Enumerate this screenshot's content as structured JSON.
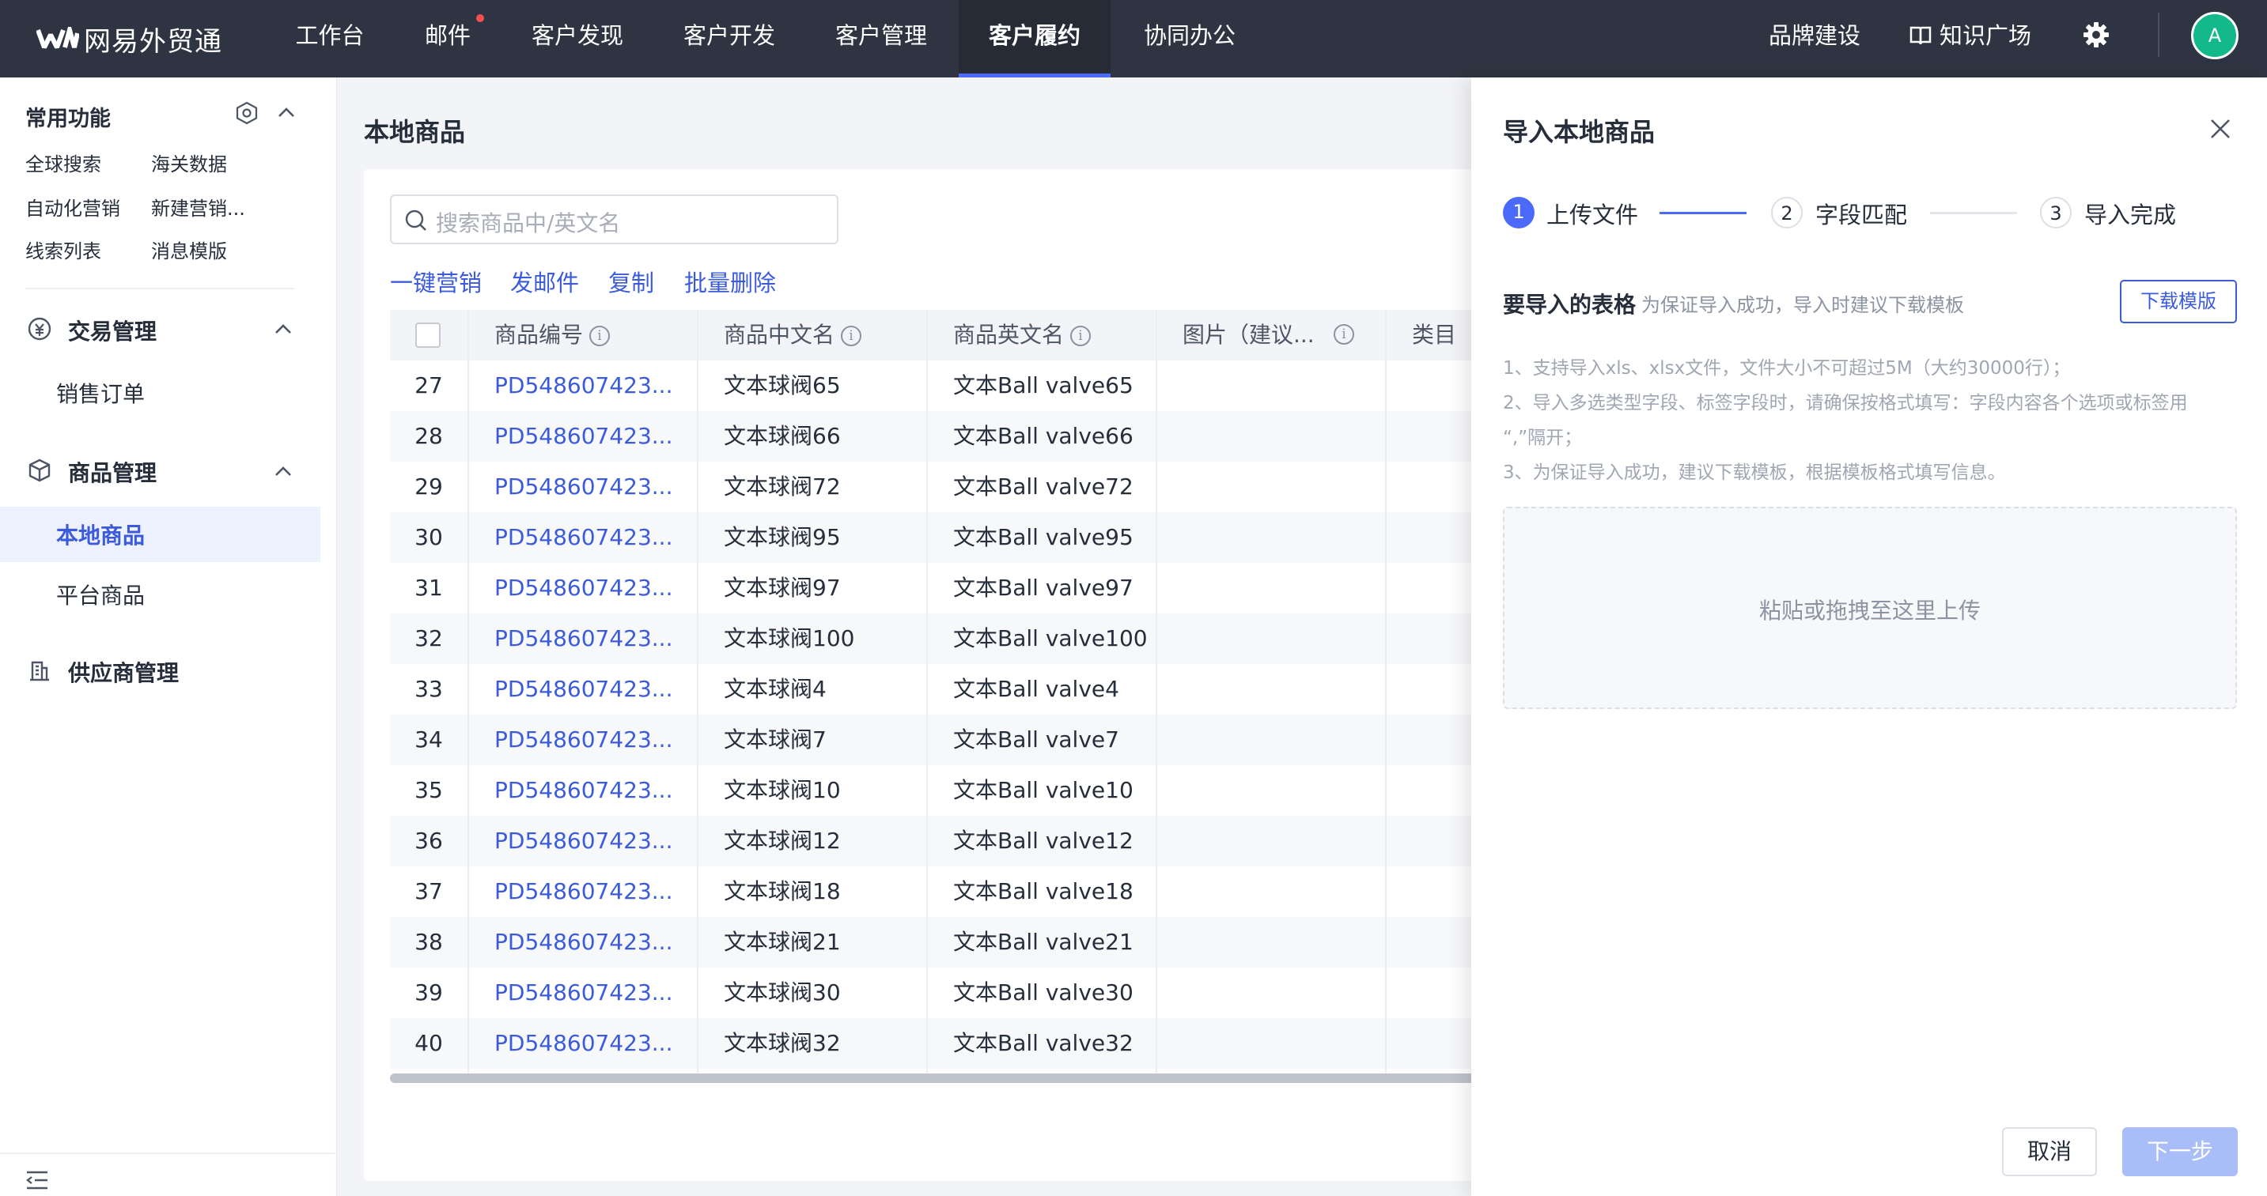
{
  "app": {
    "name": "网易外贸通"
  },
  "nav": {
    "tabs": [
      "工作台",
      "邮件",
      "客户发现",
      "客户开发",
      "客户管理",
      "客户履约",
      "协同办公"
    ],
    "active": "客户履约",
    "right": {
      "brand": "品牌建设",
      "knowledge": "知识广场",
      "avatar": "A"
    }
  },
  "sidebar": {
    "common_title": "常用功能",
    "quick_links": [
      "全球搜索",
      "海关数据",
      "自动化营销",
      "新建营销...",
      "线索列表",
      "消息模版"
    ],
    "groups": [
      {
        "title": "交易管理",
        "items": [
          "销售订单"
        ]
      },
      {
        "title": "商品管理",
        "items": [
          "本地商品",
          "平台商品"
        ]
      },
      {
        "title": "供应商管理",
        "items": []
      }
    ],
    "active_item": "本地商品"
  },
  "page": {
    "title": "本地商品",
    "search_placeholder": "搜索商品中/英文名",
    "actions": [
      "一键营销",
      "发邮件",
      "复制",
      "批量删除"
    ],
    "columns": [
      "商品编号",
      "商品中文名",
      "商品英文名",
      "图片（建议...",
      "类目"
    ],
    "rows": [
      {
        "no": "27",
        "id": "PD548607423...",
        "cn": "文本球阀65",
        "en": "文本Ball valve65"
      },
      {
        "no": "28",
        "id": "PD548607423...",
        "cn": "文本球阀66",
        "en": "文本Ball valve66"
      },
      {
        "no": "29",
        "id": "PD548607423...",
        "cn": "文本球阀72",
        "en": "文本Ball valve72"
      },
      {
        "no": "30",
        "id": "PD548607423...",
        "cn": "文本球阀95",
        "en": "文本Ball valve95"
      },
      {
        "no": "31",
        "id": "PD548607423...",
        "cn": "文本球阀97",
        "en": "文本Ball valve97"
      },
      {
        "no": "32",
        "id": "PD548607423...",
        "cn": "文本球阀100",
        "en": "文本Ball valve100"
      },
      {
        "no": "33",
        "id": "PD548607423...",
        "cn": "文本球阀4",
        "en": "文本Ball valve4"
      },
      {
        "no": "34",
        "id": "PD548607423...",
        "cn": "文本球阀7",
        "en": "文本Ball valve7"
      },
      {
        "no": "35",
        "id": "PD548607423...",
        "cn": "文本球阀10",
        "en": "文本Ball valve10"
      },
      {
        "no": "36",
        "id": "PD548607423...",
        "cn": "文本球阀12",
        "en": "文本Ball valve12"
      },
      {
        "no": "37",
        "id": "PD548607423...",
        "cn": "文本球阀18",
        "en": "文本Ball valve18"
      },
      {
        "no": "38",
        "id": "PD548607423...",
        "cn": "文本球阀21",
        "en": "文本Ball valve21"
      },
      {
        "no": "39",
        "id": "PD548607423...",
        "cn": "文本球阀30",
        "en": "文本Ball valve30"
      },
      {
        "no": "40",
        "id": "PD548607423...",
        "cn": "文本球阀32",
        "en": "文本Ball valve32"
      }
    ]
  },
  "panel": {
    "title": "导入本地商品",
    "steps": [
      {
        "num": "1",
        "label": "上传文件"
      },
      {
        "num": "2",
        "label": "字段匹配"
      },
      {
        "num": "3",
        "label": "导入完成"
      }
    ],
    "current_step": 1,
    "section_title": "要导入的表格",
    "section_hint": "为保证导入成功，导入时建议下载模板",
    "download_button": "下载模版",
    "notes": [
      "1、支持导入xls、xlsx文件，文件大小不可超过5M（大约30000行）；",
      "2、导入多选类型字段、标签字段时，请确保按格式填写：字段内容各个选项或标签用",
      "“,”隔开；",
      "3、为保证导入成功，建议下载模板，根据模板格式填写信息。"
    ],
    "upload_hint": "粘贴或拖拽至这里上传",
    "cancel_button": "取消",
    "next_button": "下一步"
  },
  "colors": {
    "nav_bg": "#2e3441",
    "primary": "#3b5bdb",
    "active_tab_underline": "#4c6afa",
    "avatar_bg": "#13b98b",
    "notify_dot": "#f5504f",
    "disabled_primary": "#a9bdf8"
  }
}
